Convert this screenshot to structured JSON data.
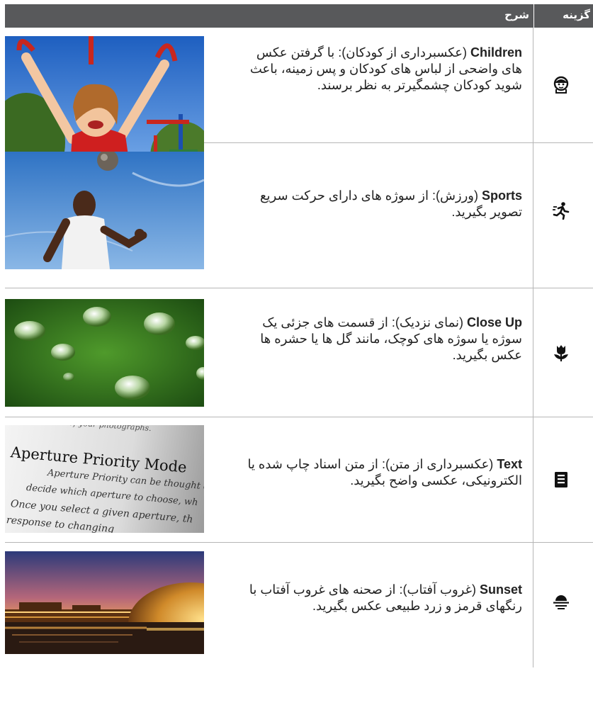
{
  "header": {
    "option": "گزینه",
    "description": "شرح"
  },
  "rows": [
    {
      "name": "Children",
      "text": " (عکسبرداری از کودکان): با گرفتن عکس های واضحی از لباس های کودکان و پس زمینه، باعث شوید کودکان چشمگیرتر به نظر برسند.",
      "icon": "child-face-icon",
      "photo": "child-playground-photo"
    },
    {
      "name": "Sports",
      "text": " (ورزش): از سوژه های دارای حرکت سریع تصویر بگیرید.",
      "icon": "running-person-icon",
      "photo": "soccer-player-photo"
    },
    {
      "name": "Close Up",
      "text": " (نمای نزدیک): از قسمت های جزئی یک سوژه یا سوژه های کوچک، مانند گل ها یا حشره ها عکس بگیرید.",
      "icon": "tulip-icon",
      "photo": "water-drops-leaf-photo"
    },
    {
      "name": "Text",
      "text": " (عکسبرداری از متن): از متن اسناد چاپ شده یا الکترونیکی، عکسی واضح بگیرید.",
      "icon": "document-text-icon",
      "photo": "printed-page-photo"
    },
    {
      "name": "Sunset",
      "text": " (غروب آفتاب): از صحنه های غروب آفتاب با رنگهای قرمز و زرد طبیعی عکس بگیرید.",
      "icon": "sunset-icon",
      "photo": "city-sunset-photo"
    }
  ],
  "photo_text": {
    "line0": "of your photographs.",
    "heading": "Aperture Priority Mode",
    "line1": "Aperture Priority can be thought of",
    "line2": "decide which aperture to choose, wh",
    "line3": "Once you select a given aperture, th",
    "line4": "response to changing"
  }
}
